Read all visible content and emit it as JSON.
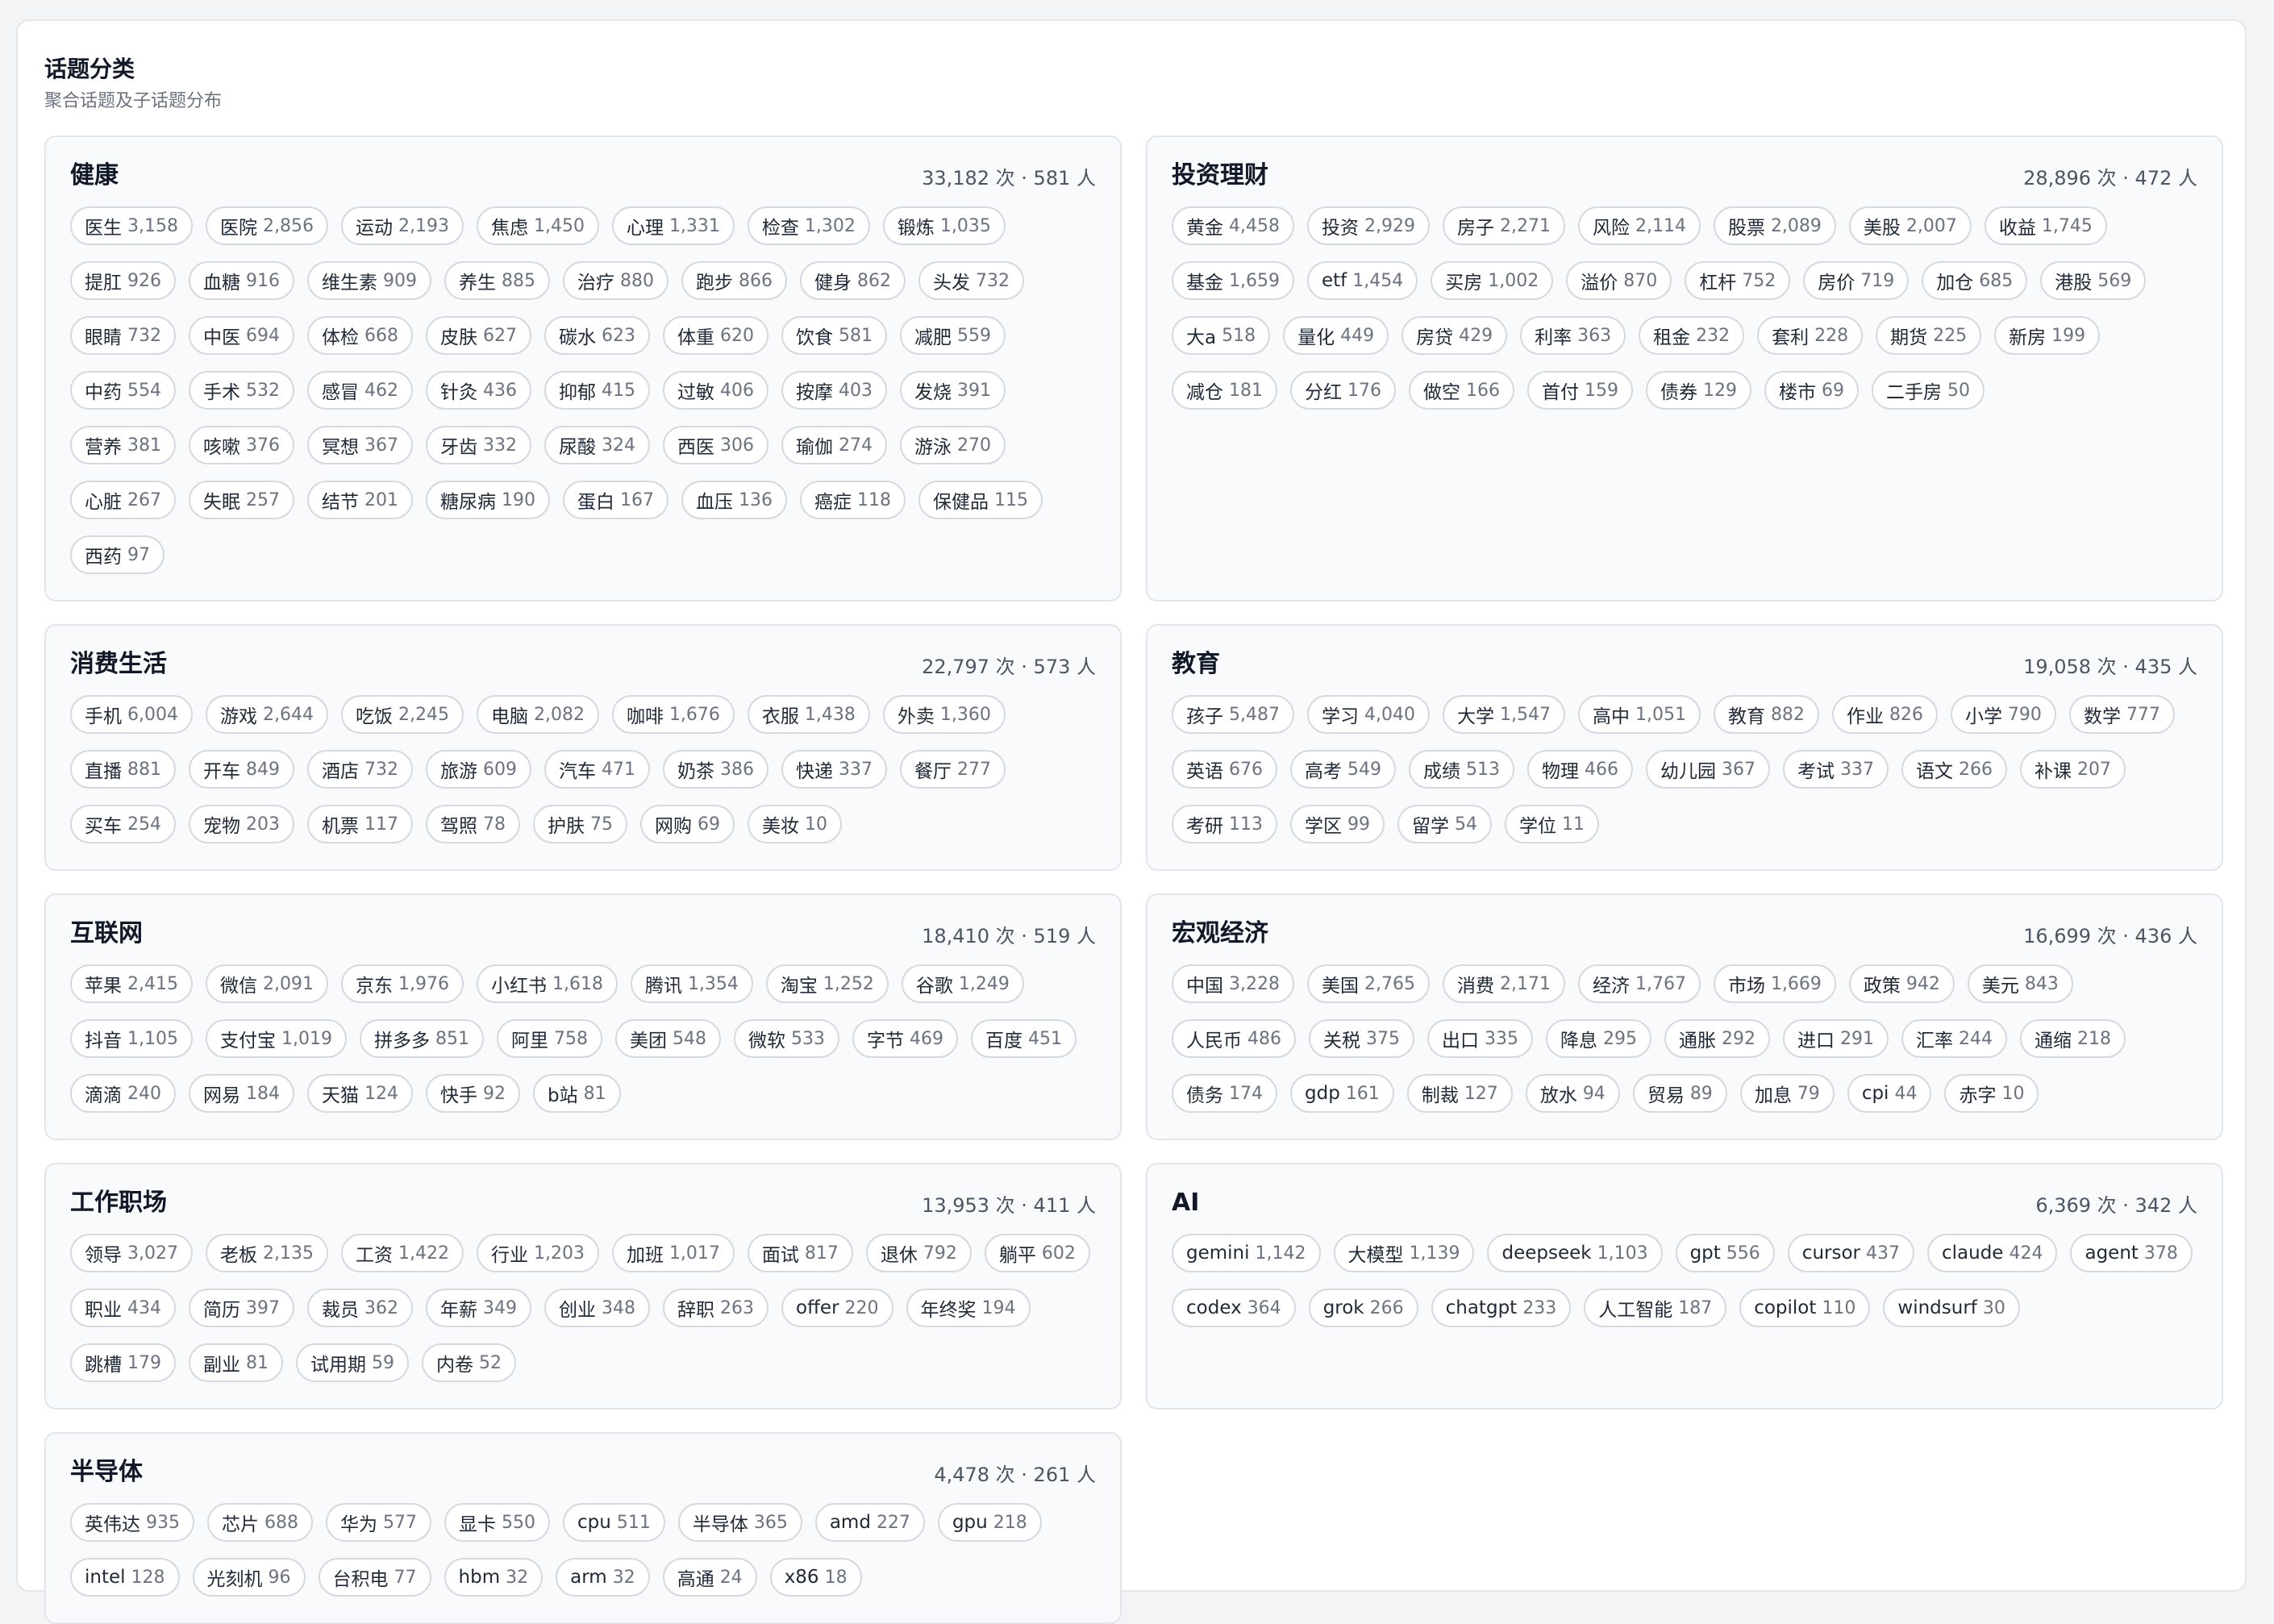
{
  "header": {
    "title": "话题分类",
    "subtitle": "聚合话题及子话题分布"
  },
  "categories": [
    {
      "title": "健康",
      "stats": "33,182 次 · 581 人",
      "tags": [
        {
          "label": "医生",
          "count": "3,158"
        },
        {
          "label": "医院",
          "count": "2,856"
        },
        {
          "label": "运动",
          "count": "2,193"
        },
        {
          "label": "焦虑",
          "count": "1,450"
        },
        {
          "label": "心理",
          "count": "1,331"
        },
        {
          "label": "检查",
          "count": "1,302"
        },
        {
          "label": "锻炼",
          "count": "1,035"
        },
        {
          "label": "提肛",
          "count": "926"
        },
        {
          "label": "血糖",
          "count": "916"
        },
        {
          "label": "维生素",
          "count": "909"
        },
        {
          "label": "养生",
          "count": "885"
        },
        {
          "label": "治疗",
          "count": "880"
        },
        {
          "label": "跑步",
          "count": "866"
        },
        {
          "label": "健身",
          "count": "862"
        },
        {
          "label": "头发",
          "count": "732"
        },
        {
          "label": "眼睛",
          "count": "732"
        },
        {
          "label": "中医",
          "count": "694"
        },
        {
          "label": "体检",
          "count": "668"
        },
        {
          "label": "皮肤",
          "count": "627"
        },
        {
          "label": "碳水",
          "count": "623"
        },
        {
          "label": "体重",
          "count": "620"
        },
        {
          "label": "饮食",
          "count": "581"
        },
        {
          "label": "减肥",
          "count": "559"
        },
        {
          "label": "中药",
          "count": "554"
        },
        {
          "label": "手术",
          "count": "532"
        },
        {
          "label": "感冒",
          "count": "462"
        },
        {
          "label": "针灸",
          "count": "436"
        },
        {
          "label": "抑郁",
          "count": "415"
        },
        {
          "label": "过敏",
          "count": "406"
        },
        {
          "label": "按摩",
          "count": "403"
        },
        {
          "label": "发烧",
          "count": "391"
        },
        {
          "label": "营养",
          "count": "381"
        },
        {
          "label": "咳嗽",
          "count": "376"
        },
        {
          "label": "冥想",
          "count": "367"
        },
        {
          "label": "牙齿",
          "count": "332"
        },
        {
          "label": "尿酸",
          "count": "324"
        },
        {
          "label": "西医",
          "count": "306"
        },
        {
          "label": "瑜伽",
          "count": "274"
        },
        {
          "label": "游泳",
          "count": "270"
        },
        {
          "label": "心脏",
          "count": "267"
        },
        {
          "label": "失眠",
          "count": "257"
        },
        {
          "label": "结节",
          "count": "201"
        },
        {
          "label": "糖尿病",
          "count": "190"
        },
        {
          "label": "蛋白",
          "count": "167"
        },
        {
          "label": "血压",
          "count": "136"
        },
        {
          "label": "癌症",
          "count": "118"
        },
        {
          "label": "保健品",
          "count": "115"
        },
        {
          "label": "西药",
          "count": "97"
        }
      ]
    },
    {
      "title": "投资理财",
      "stats": "28,896 次 · 472 人",
      "tags": [
        {
          "label": "黄金",
          "count": "4,458"
        },
        {
          "label": "投资",
          "count": "2,929"
        },
        {
          "label": "房子",
          "count": "2,271"
        },
        {
          "label": "风险",
          "count": "2,114"
        },
        {
          "label": "股票",
          "count": "2,089"
        },
        {
          "label": "美股",
          "count": "2,007"
        },
        {
          "label": "收益",
          "count": "1,745"
        },
        {
          "label": "基金",
          "count": "1,659"
        },
        {
          "label": "etf",
          "count": "1,454"
        },
        {
          "label": "买房",
          "count": "1,002"
        },
        {
          "label": "溢价",
          "count": "870"
        },
        {
          "label": "杠杆",
          "count": "752"
        },
        {
          "label": "房价",
          "count": "719"
        },
        {
          "label": "加仓",
          "count": "685"
        },
        {
          "label": "港股",
          "count": "569"
        },
        {
          "label": "大a",
          "count": "518"
        },
        {
          "label": "量化",
          "count": "449"
        },
        {
          "label": "房贷",
          "count": "429"
        },
        {
          "label": "利率",
          "count": "363"
        },
        {
          "label": "租金",
          "count": "232"
        },
        {
          "label": "套利",
          "count": "228"
        },
        {
          "label": "期货",
          "count": "225"
        },
        {
          "label": "新房",
          "count": "199"
        },
        {
          "label": "减仓",
          "count": "181"
        },
        {
          "label": "分红",
          "count": "176"
        },
        {
          "label": "做空",
          "count": "166"
        },
        {
          "label": "首付",
          "count": "159"
        },
        {
          "label": "债券",
          "count": "129"
        },
        {
          "label": "楼市",
          "count": "69"
        },
        {
          "label": "二手房",
          "count": "50"
        }
      ]
    },
    {
      "title": "消费生活",
      "stats": "22,797 次 · 573 人",
      "tags": [
        {
          "label": "手机",
          "count": "6,004"
        },
        {
          "label": "游戏",
          "count": "2,644"
        },
        {
          "label": "吃饭",
          "count": "2,245"
        },
        {
          "label": "电脑",
          "count": "2,082"
        },
        {
          "label": "咖啡",
          "count": "1,676"
        },
        {
          "label": "衣服",
          "count": "1,438"
        },
        {
          "label": "外卖",
          "count": "1,360"
        },
        {
          "label": "直播",
          "count": "881"
        },
        {
          "label": "开车",
          "count": "849"
        },
        {
          "label": "酒店",
          "count": "732"
        },
        {
          "label": "旅游",
          "count": "609"
        },
        {
          "label": "汽车",
          "count": "471"
        },
        {
          "label": "奶茶",
          "count": "386"
        },
        {
          "label": "快递",
          "count": "337"
        },
        {
          "label": "餐厅",
          "count": "277"
        },
        {
          "label": "买车",
          "count": "254"
        },
        {
          "label": "宠物",
          "count": "203"
        },
        {
          "label": "机票",
          "count": "117"
        },
        {
          "label": "驾照",
          "count": "78"
        },
        {
          "label": "护肤",
          "count": "75"
        },
        {
          "label": "网购",
          "count": "69"
        },
        {
          "label": "美妆",
          "count": "10"
        }
      ]
    },
    {
      "title": "教育",
      "stats": "19,058 次 · 435 人",
      "tags": [
        {
          "label": "孩子",
          "count": "5,487"
        },
        {
          "label": "学习",
          "count": "4,040"
        },
        {
          "label": "大学",
          "count": "1,547"
        },
        {
          "label": "高中",
          "count": "1,051"
        },
        {
          "label": "教育",
          "count": "882"
        },
        {
          "label": "作业",
          "count": "826"
        },
        {
          "label": "小学",
          "count": "790"
        },
        {
          "label": "数学",
          "count": "777"
        },
        {
          "label": "英语",
          "count": "676"
        },
        {
          "label": "高考",
          "count": "549"
        },
        {
          "label": "成绩",
          "count": "513"
        },
        {
          "label": "物理",
          "count": "466"
        },
        {
          "label": "幼儿园",
          "count": "367"
        },
        {
          "label": "考试",
          "count": "337"
        },
        {
          "label": "语文",
          "count": "266"
        },
        {
          "label": "补课",
          "count": "207"
        },
        {
          "label": "考研",
          "count": "113"
        },
        {
          "label": "学区",
          "count": "99"
        },
        {
          "label": "留学",
          "count": "54"
        },
        {
          "label": "学位",
          "count": "11"
        }
      ]
    },
    {
      "title": "互联网",
      "stats": "18,410 次 · 519 人",
      "tags": [
        {
          "label": "苹果",
          "count": "2,415"
        },
        {
          "label": "微信",
          "count": "2,091"
        },
        {
          "label": "京东",
          "count": "1,976"
        },
        {
          "label": "小红书",
          "count": "1,618"
        },
        {
          "label": "腾讯",
          "count": "1,354"
        },
        {
          "label": "淘宝",
          "count": "1,252"
        },
        {
          "label": "谷歌",
          "count": "1,249"
        },
        {
          "label": "抖音",
          "count": "1,105"
        },
        {
          "label": "支付宝",
          "count": "1,019"
        },
        {
          "label": "拼多多",
          "count": "851"
        },
        {
          "label": "阿里",
          "count": "758"
        },
        {
          "label": "美团",
          "count": "548"
        },
        {
          "label": "微软",
          "count": "533"
        },
        {
          "label": "字节",
          "count": "469"
        },
        {
          "label": "百度",
          "count": "451"
        },
        {
          "label": "滴滴",
          "count": "240"
        },
        {
          "label": "网易",
          "count": "184"
        },
        {
          "label": "天猫",
          "count": "124"
        },
        {
          "label": "快手",
          "count": "92"
        },
        {
          "label": "b站",
          "count": "81"
        }
      ]
    },
    {
      "title": "宏观经济",
      "stats": "16,699 次 · 436 人",
      "tags": [
        {
          "label": "中国",
          "count": "3,228"
        },
        {
          "label": "美国",
          "count": "2,765"
        },
        {
          "label": "消费",
          "count": "2,171"
        },
        {
          "label": "经济",
          "count": "1,767"
        },
        {
          "label": "市场",
          "count": "1,669"
        },
        {
          "label": "政策",
          "count": "942"
        },
        {
          "label": "美元",
          "count": "843"
        },
        {
          "label": "人民币",
          "count": "486"
        },
        {
          "label": "关税",
          "count": "375"
        },
        {
          "label": "出口",
          "count": "335"
        },
        {
          "label": "降息",
          "count": "295"
        },
        {
          "label": "通胀",
          "count": "292"
        },
        {
          "label": "进口",
          "count": "291"
        },
        {
          "label": "汇率",
          "count": "244"
        },
        {
          "label": "通缩",
          "count": "218"
        },
        {
          "label": "债务",
          "count": "174"
        },
        {
          "label": "gdp",
          "count": "161"
        },
        {
          "label": "制裁",
          "count": "127"
        },
        {
          "label": "放水",
          "count": "94"
        },
        {
          "label": "贸易",
          "count": "89"
        },
        {
          "label": "加息",
          "count": "79"
        },
        {
          "label": "cpi",
          "count": "44"
        },
        {
          "label": "赤字",
          "count": "10"
        }
      ]
    },
    {
      "title": "工作职场",
      "stats": "13,953 次 · 411 人",
      "tags": [
        {
          "label": "领导",
          "count": "3,027"
        },
        {
          "label": "老板",
          "count": "2,135"
        },
        {
          "label": "工资",
          "count": "1,422"
        },
        {
          "label": "行业",
          "count": "1,203"
        },
        {
          "label": "加班",
          "count": "1,017"
        },
        {
          "label": "面试",
          "count": "817"
        },
        {
          "label": "退休",
          "count": "792"
        },
        {
          "label": "躺平",
          "count": "602"
        },
        {
          "label": "职业",
          "count": "434"
        },
        {
          "label": "简历",
          "count": "397"
        },
        {
          "label": "裁员",
          "count": "362"
        },
        {
          "label": "年薪",
          "count": "349"
        },
        {
          "label": "创业",
          "count": "348"
        },
        {
          "label": "辞职",
          "count": "263"
        },
        {
          "label": "offer",
          "count": "220"
        },
        {
          "label": "年终奖",
          "count": "194"
        },
        {
          "label": "跳槽",
          "count": "179"
        },
        {
          "label": "副业",
          "count": "81"
        },
        {
          "label": "试用期",
          "count": "59"
        },
        {
          "label": "内卷",
          "count": "52"
        }
      ]
    },
    {
      "title": "AI",
      "stats": "6,369 次 · 342 人",
      "tags": [
        {
          "label": "gemini",
          "count": "1,142"
        },
        {
          "label": "大模型",
          "count": "1,139"
        },
        {
          "label": "deepseek",
          "count": "1,103"
        },
        {
          "label": "gpt",
          "count": "556"
        },
        {
          "label": "cursor",
          "count": "437"
        },
        {
          "label": "claude",
          "count": "424"
        },
        {
          "label": "agent",
          "count": "378"
        },
        {
          "label": "codex",
          "count": "364"
        },
        {
          "label": "grok",
          "count": "266"
        },
        {
          "label": "chatgpt",
          "count": "233"
        },
        {
          "label": "人工智能",
          "count": "187"
        },
        {
          "label": "copilot",
          "count": "110"
        },
        {
          "label": "windsurf",
          "count": "30"
        }
      ]
    },
    {
      "title": "半导体",
      "stats": "4,478 次 · 261 人",
      "tags": [
        {
          "label": "英伟达",
          "count": "935"
        },
        {
          "label": "芯片",
          "count": "688"
        },
        {
          "label": "华为",
          "count": "577"
        },
        {
          "label": "显卡",
          "count": "550"
        },
        {
          "label": "cpu",
          "count": "511"
        },
        {
          "label": "半导体",
          "count": "365"
        },
        {
          "label": "amd",
          "count": "227"
        },
        {
          "label": "gpu",
          "count": "218"
        },
        {
          "label": "intel",
          "count": "128"
        },
        {
          "label": "光刻机",
          "count": "96"
        },
        {
          "label": "台积电",
          "count": "77"
        },
        {
          "label": "hbm",
          "count": "32"
        },
        {
          "label": "arm",
          "count": "32"
        },
        {
          "label": "高通",
          "count": "24"
        },
        {
          "label": "x86",
          "count": "18"
        }
      ]
    }
  ]
}
